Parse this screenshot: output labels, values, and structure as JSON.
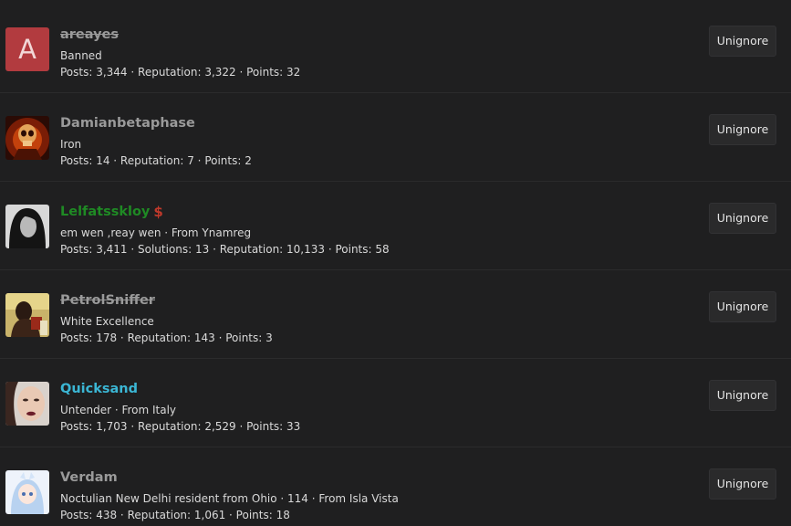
{
  "button_label": "Unignore",
  "members": [
    {
      "username": "areayes",
      "avatar_letter": "A",
      "subtitle": "Banned",
      "stats": "Posts: 3,344 · Reputation: 3,322 · Points: 32"
    },
    {
      "username": "Damianbetaphase",
      "subtitle": "Iron",
      "stats": "Posts: 14 · Reputation: 7 · Points: 2"
    },
    {
      "username": "Lelfatsskloy",
      "badge_icon": "dollar-badge-icon",
      "subtitle": "em wen ,reay wen · From Ynamreg",
      "stats": "Posts: 3,411 · Solutions: 13 · Reputation: 10,133 · Points: 58"
    },
    {
      "username": "PetrolSniffer",
      "subtitle": "White Excellence",
      "stats": "Posts: 178 · Reputation: 143 · Points: 3"
    },
    {
      "username": "Quicksand",
      "subtitle": "Untender · From Italy",
      "stats": "Posts: 1,703 · Reputation: 2,529 · Points: 33"
    },
    {
      "username": "Verdam",
      "subtitle": "Noctulian New Delhi resident from Ohio · 114 · From Isla Vista",
      "stats": "Posts: 438 · Reputation: 1,061 · Points: 18"
    }
  ],
  "colors": {
    "background": "#1f1f20",
    "banned_avatar": "#b23b3f",
    "green_username": "#1f8a24",
    "cyan_username": "#3bb6d4",
    "default_username": "#9a9a9a"
  }
}
